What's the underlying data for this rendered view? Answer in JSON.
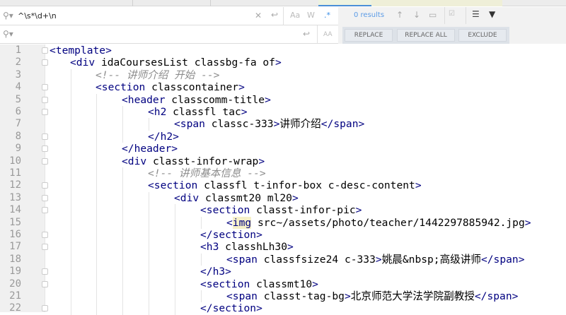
{
  "find": {
    "query": "^\\s*\\d+\\n",
    "replace_value": "",
    "match_case": "Aa",
    "words": "W",
    "regex": ".*",
    "results": "0 results"
  },
  "replace": {
    "buttons": [
      "REPLACE",
      "REPLACE ALL",
      "EXCLUDE"
    ]
  },
  "icons": [
    "search-icon",
    "clear-icon",
    "newline-icon",
    "prev-icon",
    "next-icon",
    "select-all-icon",
    "in-selection-icon",
    "multiline-icon",
    "filter-icon",
    "preserve-case-icon"
  ],
  "editor": {
    "lines": [
      {
        "n": "1",
        "indent": 0,
        "text": "<template>"
      },
      {
        "n": "2",
        "indent": 1,
        "text": "<div id=\"aCoursesList\" class=\"bg-fa of\">"
      },
      {
        "n": "3",
        "indent": 2,
        "text": "<!-- 讲师介绍 开始 -->"
      },
      {
        "n": "4",
        "indent": 2,
        "text": "<section class=\"container\">"
      },
      {
        "n": "5",
        "indent": 3,
        "text": "<header class=\"comm-title\">"
      },
      {
        "n": "6",
        "indent": 4,
        "text": "<h2 class=\"fl tac\">"
      },
      {
        "n": "7",
        "indent": 5,
        "text": "<span class=\"c-333\">讲师介绍</span>"
      },
      {
        "n": "8",
        "indent": 4,
        "text": "</h2>"
      },
      {
        "n": "9",
        "indent": 3,
        "text": "</header>"
      },
      {
        "n": "10",
        "indent": 3,
        "text": "<div class=\"t-infor-wrap\">"
      },
      {
        "n": "11",
        "indent": 4,
        "text": "<!-- 讲师基本信息 -->"
      },
      {
        "n": "12",
        "indent": 4,
        "text": "<section class=\"fl t-infor-box c-desc-content\">"
      },
      {
        "n": "13",
        "indent": 5,
        "text": "<div class=\"mt20 ml20\">"
      },
      {
        "n": "14",
        "indent": 6,
        "text": "<section class=\"t-infor-pic\">"
      },
      {
        "n": "15",
        "indent": 7,
        "text": "<img src=\"~/assets/photo/teacher/1442297885942.jpg\">"
      },
      {
        "n": "16",
        "indent": 6,
        "text": "</section>"
      },
      {
        "n": "17",
        "indent": 6,
        "text": "<h3 class=\"hLh30\">"
      },
      {
        "n": "18",
        "indent": 7,
        "text": "<span class=\"fsize24 c-333\">姚晨&nbsp;高级讲师</span>"
      },
      {
        "n": "19",
        "indent": 6,
        "text": "</h3>"
      },
      {
        "n": "20",
        "indent": 6,
        "text": "<section class=\"mt10\">"
      },
      {
        "n": "21",
        "indent": 7,
        "text": "<span class=\"t-tag-bg\">北京师范大学法学院副教授</span>"
      },
      {
        "n": "22",
        "indent": 6,
        "text": "</section>"
      }
    ],
    "folds": [
      "1",
      "2",
      "4",
      "5",
      "6",
      "8",
      "9",
      "10",
      "12",
      "13",
      "14",
      "16",
      "17",
      "19",
      "20",
      "22"
    ]
  }
}
